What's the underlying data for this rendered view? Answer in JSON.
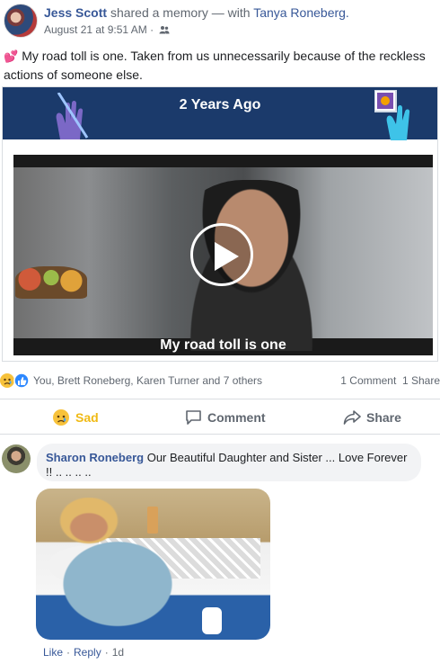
{
  "post": {
    "author": "Jess Scott",
    "action_text": "shared a memory — with",
    "tagged": "Tanya Roneberg.",
    "timestamp": "August 21 at 9:51 AM",
    "separator": "·",
    "privacy_icon": "friends-icon",
    "text": "My road toll is one. Taken from us unnecessarily because of the reckless actions of someone else."
  },
  "memory": {
    "banner_title": "2 Years Ago",
    "banner_color": "#1b3a6b",
    "video_caption": "My road toll is one"
  },
  "reactions": {
    "icons": [
      "sad-icon",
      "like-icon"
    ],
    "names": "You, Brett Roneberg, Karen Turner and 7 others",
    "comments_count": "1 Comment",
    "shares_count": "1 Share"
  },
  "actions": {
    "sad_label": "Sad",
    "comment_label": "Comment",
    "share_label": "Share"
  },
  "comment": {
    "author": "Sharon Roneberg",
    "text": "Our Beautiful Daughter and Sister ... Love Forever !! .. .. .. ..",
    "like_label": "Like",
    "reply_label": "Reply",
    "time": "1d"
  },
  "colors": {
    "link": "#385898",
    "sad": "#f0ba15",
    "muted": "#606770"
  }
}
